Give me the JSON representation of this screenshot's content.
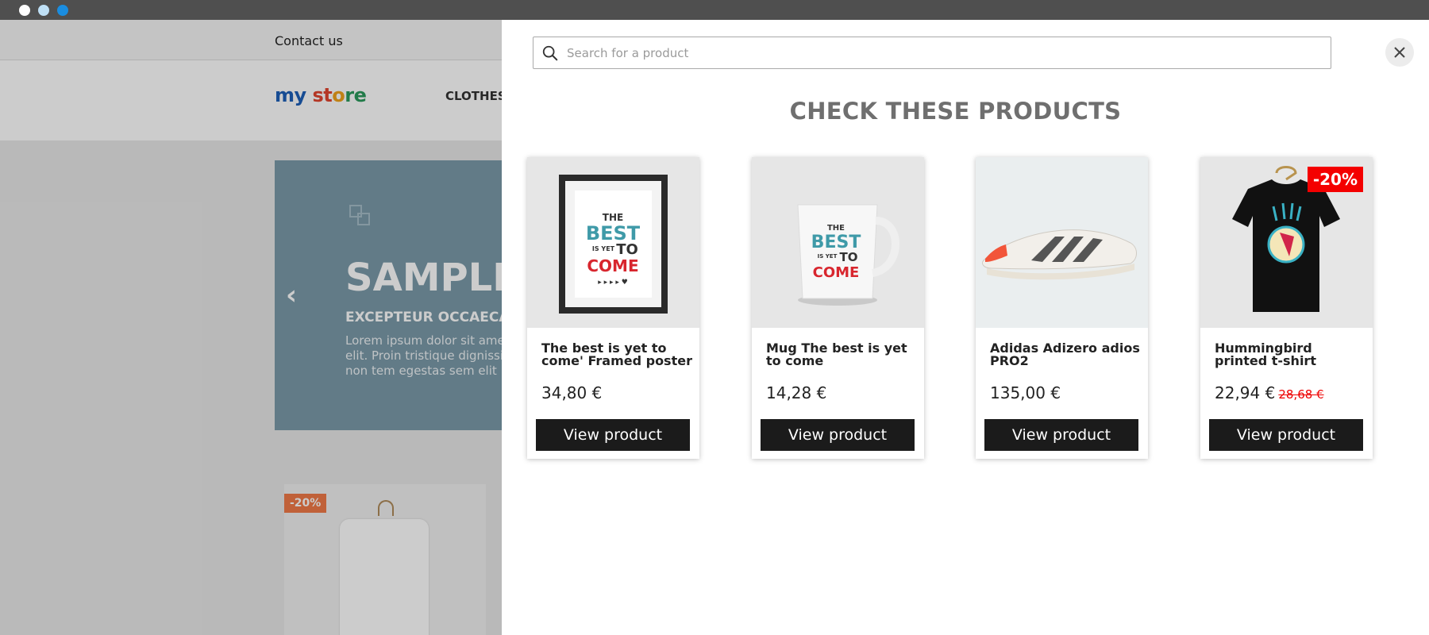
{
  "window": {
    "dots": [
      "#ffffff",
      "#bfe0f6",
      "#1a8de0"
    ]
  },
  "store": {
    "topbar": {
      "contact_label": "Contact us"
    },
    "logo": {
      "part1": "my",
      "part2": "st",
      "part3": "o",
      "part4": "re"
    },
    "nav": [
      {
        "label": "CLOTHES"
      }
    ],
    "slider": {
      "title": "SAMPLE",
      "subtitle": "EXCEPTEUR OCCAECAT",
      "text": "Lorem ipsum dolor sit amet adipiscing elit. Proin tristique dignissim. Quisque non tem egestas sem elit"
    },
    "bg_product": {
      "badge": "-20%"
    }
  },
  "search": {
    "placeholder": "Search for a product",
    "value": "",
    "close_label": "✕"
  },
  "suggestions": {
    "heading": "CHECK THESE PRODUCTS",
    "products": [
      {
        "name": "The best is yet to come' Framed poster",
        "price": "34,80 €",
        "old_price": "",
        "badge": "",
        "button": "View product"
      },
      {
        "name": "Mug The best is yet to come",
        "price": "14,28 €",
        "old_price": "",
        "badge": "",
        "button": "View product"
      },
      {
        "name": "Adidas Adizero adios PRO2",
        "price": "135,00 €",
        "old_price": "",
        "badge": "",
        "button": "View product"
      },
      {
        "name": "Hummingbird printed t-shirt",
        "price": "22,94 €",
        "old_price": "28,68 €",
        "badge": "-20%",
        "button": "View product"
      }
    ],
    "poster_art": [
      "THE",
      "BEST",
      "IS YET",
      "TO",
      "COME"
    ]
  }
}
